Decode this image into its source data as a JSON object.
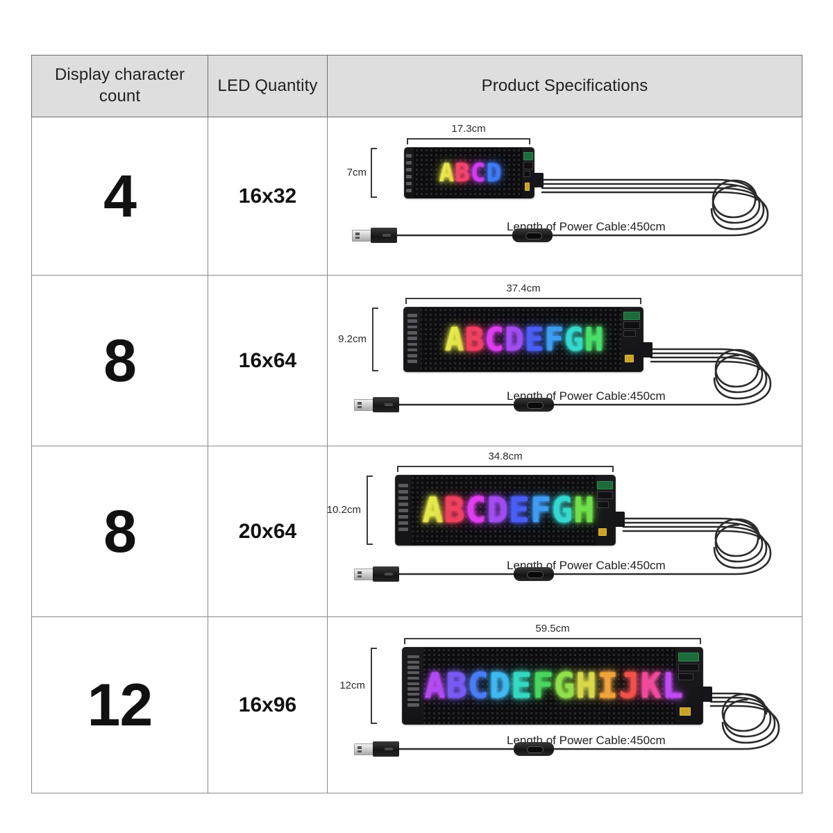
{
  "table": {
    "headers": [
      {
        "id": "display-character-count",
        "label": "Display character count"
      },
      {
        "id": "led-quantity",
        "label": "LED Quantity"
      },
      {
        "id": "product-specifications",
        "label": "Product Specifications"
      }
    ],
    "rows": [
      {
        "character_count": "4",
        "led_quantity": "16x32",
        "width_label": "17.3cm",
        "height_label": "7cm",
        "display_text": "ABCD",
        "led_colors": [
          "#e8ea4b",
          "#f2456a",
          "#d03df0",
          "#3f7bf5"
        ],
        "cable_label": "Length of Power Cable:450cm"
      },
      {
        "character_count": "8",
        "led_quantity": "16x64",
        "width_label": "37.4cm",
        "height_label": "9.2cm",
        "display_text": "ABCDEFGH",
        "led_colors": [
          "#e4e84a",
          "#f0405f",
          "#e03cf0",
          "#a24cf2",
          "#4a5ef5",
          "#3f9cf2",
          "#35d8cf",
          "#49e06a"
        ],
        "cable_label": "Length of Power Cable:450cm"
      },
      {
        "character_count": "8",
        "led_quantity": "20x64",
        "width_label": "34.8cm",
        "height_label": "10.2cm",
        "display_text": "ABCDEFGH",
        "led_colors": [
          "#e4e84a",
          "#f0405f",
          "#e03cf0",
          "#a24cf2",
          "#4a5ef5",
          "#3f9cf2",
          "#35d8cf",
          "#6fe04a"
        ],
        "cable_label": "Length of Power Cable:450cm"
      },
      {
        "character_count": "12",
        "led_quantity": "16x96",
        "width_label": "59.5cm",
        "height_label": "12cm",
        "display_text": "ABCDEFGHIJKL",
        "led_colors": [
          "#b44bf2",
          "#7a5af5",
          "#4a7df5",
          "#3fb8f2",
          "#35d8c0",
          "#49d65e",
          "#8fe04a",
          "#d8d84a",
          "#f0a43c",
          "#f2504a",
          "#f04a9c",
          "#c04af2"
        ],
        "cable_label": "Length of Power Cable:450cm"
      }
    ]
  },
  "colors": {
    "header_bg": "#dedede",
    "border": "#8a8a8a",
    "board_bg": "#0d0d0f",
    "text": "#1a1a1a",
    "cable": "#2b2b2b"
  }
}
